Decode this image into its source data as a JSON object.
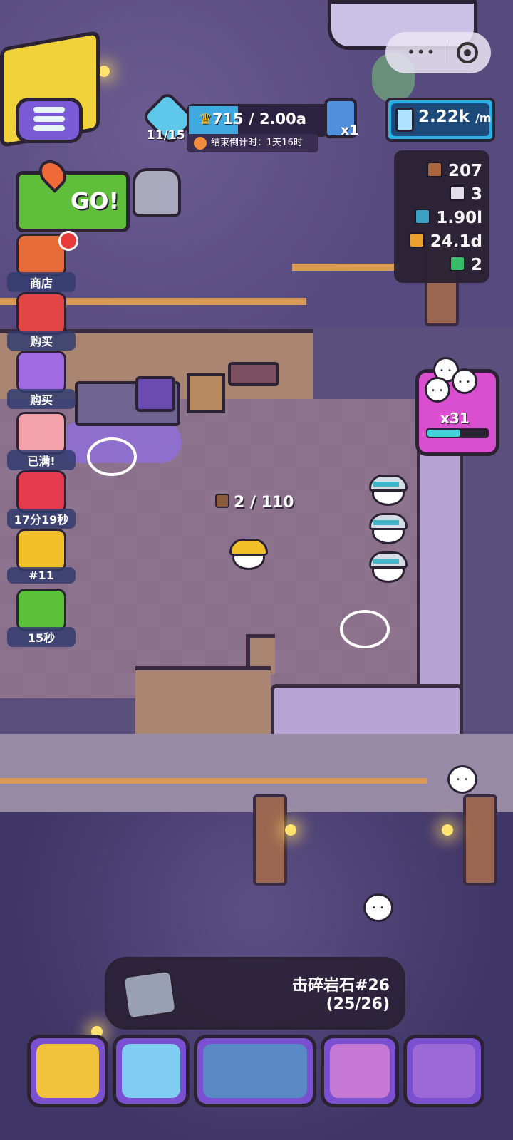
{
  "hud": {
    "pickaxe_count": "11/15",
    "crown_value": "715 / 2.00a",
    "countdown_label": "结束倒计时：",
    "countdown_time": "1天16时",
    "bag_count": "x1",
    "rate_value": "2.22k",
    "rate_unit": "/m",
    "crown_progress": 0.36
  },
  "resources": [
    {
      "name": "wood-ore",
      "value": "207",
      "color": "#b0683c"
    },
    {
      "name": "white-crystal",
      "value": "3",
      "color": "#e9e6ef"
    },
    {
      "name": "blue-gem",
      "value": "1.90l",
      "color": "#3aa6c9"
    },
    {
      "name": "gold-ore",
      "value": "24.1d",
      "color": "#f2a62a"
    },
    {
      "name": "emerald",
      "value": "2",
      "color": "#36c46b"
    }
  ],
  "go_button": {
    "label": "GO!"
  },
  "side_menu": [
    {
      "label": "商店",
      "color": "#e86b3a",
      "badge": true
    },
    {
      "label": "购买",
      "color": "#e24545",
      "badge": false
    },
    {
      "label": "购买",
      "color": "#a06ae0",
      "badge": false
    },
    {
      "label": "已满!",
      "color": "#f2a2a8",
      "badge": false
    },
    {
      "label": "17分19秒",
      "color": "#e83a4f",
      "badge": false
    },
    {
      "label": "#11",
      "color": "#f2c12a",
      "badge": false
    },
    {
      "label": "15秒",
      "color": "#5cc23a",
      "badge": false
    }
  ],
  "multiplier": {
    "label": "x31",
    "progress": 0.55
  },
  "carry": {
    "value": "2 / 110"
  },
  "quest": {
    "title": "击碎岩石#26",
    "progress": "(25/26)"
  },
  "bottom_bar": [
    {
      "name": "miner",
      "color": "#f1c33c"
    },
    {
      "name": "cards",
      "color": "#7fcdf0"
    },
    {
      "name": "mine-cart",
      "color": "#5a8ac6"
    },
    {
      "name": "workers",
      "color": "#c67ad6"
    },
    {
      "name": "upgrade-hammer",
      "color": "#9b6ad6"
    }
  ]
}
